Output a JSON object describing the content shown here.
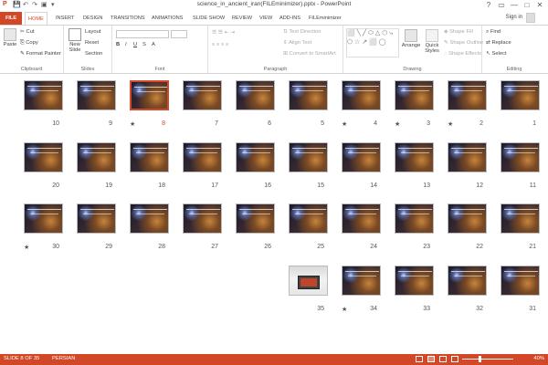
{
  "window": {
    "title": "science_in_ancient_iran(FILEminimizer).pptx - PowerPoint",
    "controls": [
      "?",
      "▭",
      "—",
      "□",
      "✕"
    ],
    "sign_in": "Sign in"
  },
  "tabs": [
    {
      "label": "FILE"
    },
    {
      "label": "HOME"
    },
    {
      "label": "INSERT"
    },
    {
      "label": "DESIGN"
    },
    {
      "label": "TRANSITIONS"
    },
    {
      "label": "ANIMATIONS"
    },
    {
      "label": "SLIDE SHOW"
    },
    {
      "label": "REVIEW"
    },
    {
      "label": "VIEW"
    },
    {
      "label": "ADD-INS"
    },
    {
      "label": "FILEminimizer"
    }
  ],
  "ribbon": {
    "clipboard": {
      "label": "Clipboard",
      "paste": "Paste",
      "cut": "Cut",
      "copy": "Copy",
      "format_painter": "Format Painter"
    },
    "slides": {
      "label": "Slides",
      "new_slide": "New Slide",
      "layout": "Layout",
      "reset": "Reset",
      "section": "Section"
    },
    "font": {
      "label": "Font"
    },
    "paragraph": {
      "label": "Paragraph",
      "text_direction": "Text Direction",
      "align_text": "Align Text",
      "convert": "Convert to SmartArt"
    },
    "drawing": {
      "label": "Drawing",
      "arrange": "Arrange",
      "quick_styles": "Quick Styles",
      "shape_fill": "Shape Fill",
      "shape_outline": "Shape Outline",
      "shape_effects": "Shape Effects"
    },
    "editing": {
      "label": "Editing",
      "find": "Find",
      "replace": "Replace",
      "select": "Select"
    }
  },
  "slides": [
    {
      "n": "1"
    },
    {
      "n": "2",
      "star": true
    },
    {
      "n": "3",
      "star": true
    },
    {
      "n": "4",
      "star": true
    },
    {
      "n": "5"
    },
    {
      "n": "6"
    },
    {
      "n": "7"
    },
    {
      "n": "8",
      "star": true,
      "selected": true
    },
    {
      "n": "9"
    },
    {
      "n": "10"
    },
    {
      "n": "11"
    },
    {
      "n": "12"
    },
    {
      "n": "13"
    },
    {
      "n": "14"
    },
    {
      "n": "15"
    },
    {
      "n": "16"
    },
    {
      "n": "17"
    },
    {
      "n": "18"
    },
    {
      "n": "19"
    },
    {
      "n": "20"
    },
    {
      "n": "21"
    },
    {
      "n": "22"
    },
    {
      "n": "23"
    },
    {
      "n": "24"
    },
    {
      "n": "25"
    },
    {
      "n": "26"
    },
    {
      "n": "27"
    },
    {
      "n": "28"
    },
    {
      "n": "29"
    },
    {
      "n": "30",
      "star": true
    },
    {
      "n": "31"
    },
    {
      "n": "32"
    },
    {
      "n": "33"
    },
    {
      "n": "34",
      "star": true
    },
    {
      "n": "35",
      "photo": true
    }
  ],
  "status": {
    "slide": "SLIDE 8 OF 35",
    "language": "PERSIAN",
    "zoom": "40%"
  },
  "colors": {
    "accent": "#d24726"
  }
}
